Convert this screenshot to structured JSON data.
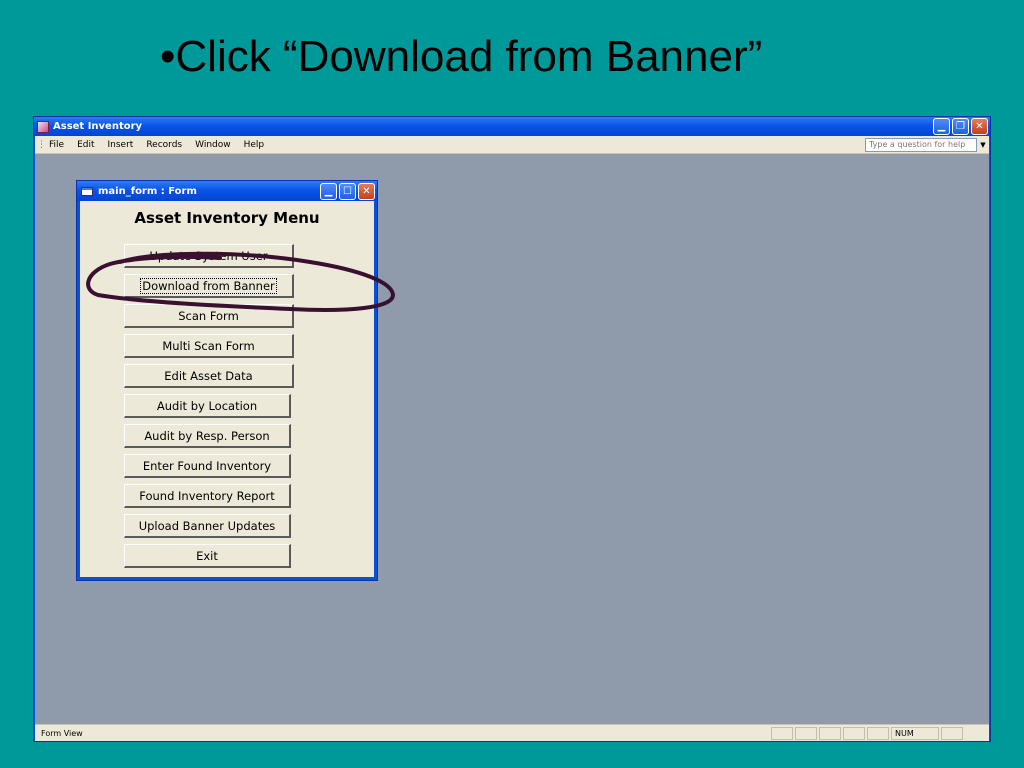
{
  "slide": {
    "title": "•Click “Download from Banner”"
  },
  "app": {
    "title": "Asset Inventory",
    "menus": [
      "File",
      "Edit",
      "Insert",
      "Records",
      "Window",
      "Help"
    ],
    "ask_placeholder": "Type a question for help",
    "status_text": "Form View",
    "status_num": "NUM"
  },
  "form": {
    "title": "main_form : Form",
    "heading": "Asset Inventory Menu",
    "buttons": [
      "Update System User",
      "Download from Banner",
      "Scan Form",
      "Multi Scan Form",
      "Edit Asset Data",
      "Audit by Location",
      "Audit by Resp. Person",
      "Enter Found Inventory",
      "Found Inventory Report",
      "Upload Banner Updates",
      "Exit"
    ]
  },
  "colors": {
    "slide_bg": "#009999",
    "titlebar": "#0a55e6",
    "workspace": "#8f9aab",
    "annotation": "#3a1030"
  }
}
